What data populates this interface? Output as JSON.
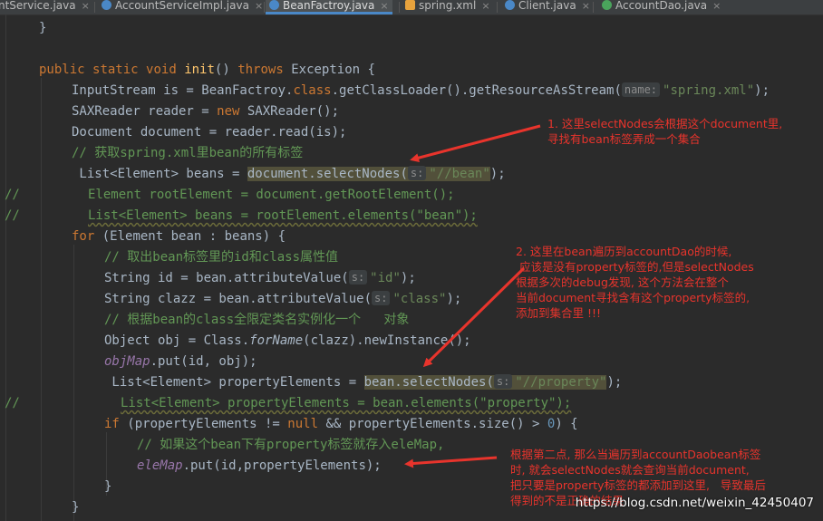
{
  "tabs": [
    {
      "label": "ntService.java",
      "icon_color": "#4a88c7",
      "active": false
    },
    {
      "label": "AccountServiceImpl.java",
      "icon_color": "#4a88c7",
      "active": false
    },
    {
      "label": "BeanFactroy.java",
      "icon_color": "#4a88c7",
      "active": true
    },
    {
      "label": "spring.xml",
      "icon_color": "#e8a33d",
      "active": false
    },
    {
      "label": "Client.java",
      "icon_color": "#4a88c7",
      "active": false
    },
    {
      "label": "AccountDao.java",
      "icon_color": "#4aa35c",
      "active": false
    }
  ],
  "tab_close_glyph": "×",
  "code": {
    "l1_brace": "}",
    "l2_kw1": "public",
    "l2_kw2": "static",
    "l2_kw3": "void",
    "l2_method": "init",
    "l2_paren": "()",
    "l2_kw4": "throws",
    "l2_rest": "Exception {",
    "l3_a": "InputStream is = BeanFactroy.",
    "l3_kw": "class",
    "l3_b": ".getClassLoader().getResourceAsStream(",
    "l3_hint": "name:",
    "l3_str": "\"spring.xml\"",
    "l3_c": ");",
    "l4_a": "SAXReader reader = ",
    "l4_kw": "new",
    "l4_b": " SAXReader();",
    "l5": "Document document = reader.read(is);",
    "l6": "// 获取spring.xml里bean的所有标签",
    "l7_a": " List<Element> beans = ",
    "l7_hl": "document.selectNodes(",
    "l7_hint": "s:",
    "l7_str": "\"//bean\"",
    "l7_c": ");",
    "l8_prefix": "//",
    "l8": "Element rootElement = document.getRootElement();",
    "l9_prefix": "//",
    "l9": "List<Element> beans = rootElement.elements(\"bean\");",
    "l10_kw": "for",
    "l10_rest": " (Element bean : beans) {",
    "l11": "// 取出bean标签里的id和class属性值",
    "l12_a": "String id = bean.attributeValue(",
    "l12_hint": "s:",
    "l12_str": "\"id\"",
    "l12_c": ");",
    "l13_a": "String clazz = bean.attributeValue(",
    "l13_hint": "s:",
    "l13_str": "\"class\"",
    "l13_c": ");",
    "l14": "// 根据bean的class全限定类名实例化一个   对象",
    "l15_a": "Object obj = Class.",
    "l15_it": "forName",
    "l15_b": "(clazz).newInstance();",
    "l16_fld": "objMap",
    "l16_b": ".put(id, obj);",
    "l17_a": " List<Element> propertyElements = ",
    "l17_hl": "bean.selectNodes(",
    "l17_hint": "s:",
    "l17_str": "\"//property\"",
    "l17_c": ");",
    "l18_prefix": "//",
    "l18": "List<Element> propertyElements = bean.elements(\"property\");",
    "l19_kw": "if",
    "l19_a": " (propertyElements != ",
    "l19_kw2": "null",
    "l19_b": " && propertyElements.size() > ",
    "l19_num": "0",
    "l19_c": ") {",
    "l20": "// 如果这个bean下有property标签就存入eleMap,",
    "l21_fld": "eleMap",
    "l21_b": ".put(id,propertyElements);",
    "l22_brace": "}",
    "l23_brace": "}"
  },
  "notes": {
    "note1": "1. 这里selectNodes会根据这个document里,\n寻找有bean标签弄成一个集合",
    "note2": "2. 这里在bean遍历到accountDao的时候,\n 应该是没有property标签的,但是selectNodes\n根据多次的debug发现, 这个方法会在整个\n当前document寻找含有这个property标签的,\n添加到集合里 !!!",
    "note3": "根据第二点, 那么当遍历到accountDaobean标签\n时, 就会selectNodes就会查询当前document,\n把只要是property标签的都添加到这里,   导致最后\n得到的不是正确的结果"
  },
  "watermark": "https://blog.csdn.net/weixin_42450407",
  "colors": {
    "background": "#2b2b2b",
    "annotation_red": "#e8342c",
    "keyword": "#cc7832",
    "string": "#6a8759",
    "comment": "#629755"
  }
}
